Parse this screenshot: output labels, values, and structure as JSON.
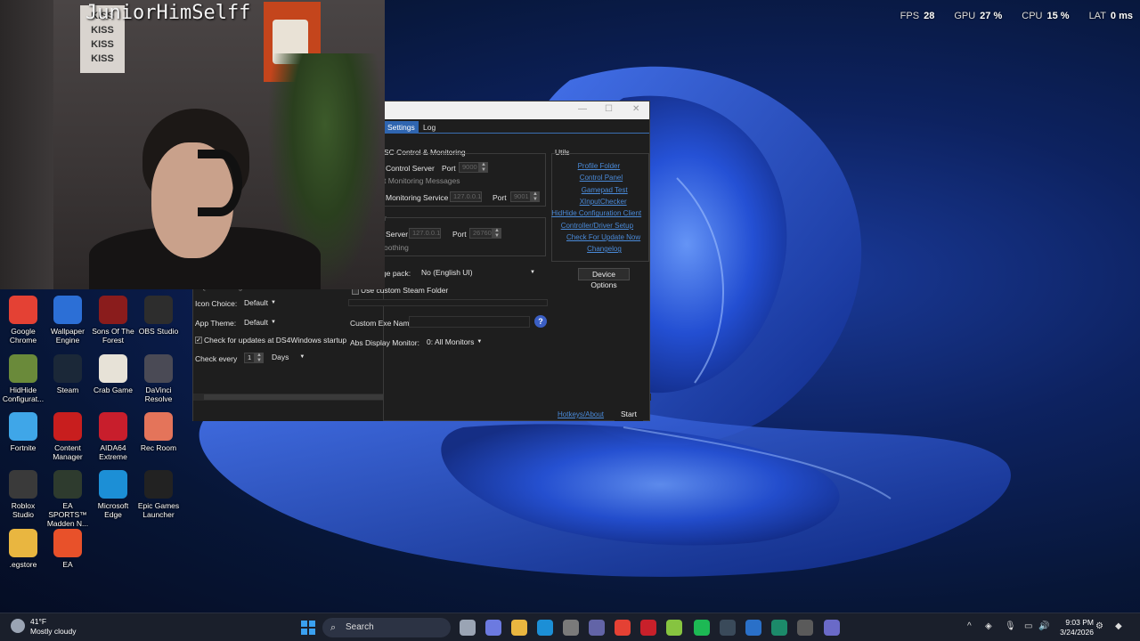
{
  "overlay": {
    "fps_label": "FPS",
    "fps": "28",
    "gpu_label": "GPU",
    "gpu": "27 %",
    "cpu_label": "CPU",
    "cpu": "15 %",
    "lat_label": "LAT",
    "lat": "0 ms"
  },
  "webcam": {
    "name": "JuniorHimSelff",
    "poster_text": [
      "KISS",
      "KISS",
      "KISS",
      "KISS"
    ]
  },
  "desktop_icons": [
    {
      "label": "Google Chrome",
      "icon": "chrome-icon",
      "color": "#e44134"
    },
    {
      "label": "Wallpaper Engine",
      "icon": "wallpaper-engine-icon",
      "color": "#2c6fd6"
    },
    {
      "label": "Sons Of The Forest",
      "icon": "sons-of-the-forest-icon",
      "color": "#8a1c1c"
    },
    {
      "label": "OBS Studio",
      "icon": "obs-icon",
      "color": "#2d2d2d"
    },
    {
      "label": "HidHide Configurat...",
      "icon": "hidhide-icon",
      "color": "#6a8a3a"
    },
    {
      "label": "Steam",
      "icon": "steam-icon",
      "color": "#1b2838"
    },
    {
      "label": "Crab Game",
      "icon": "crab-game-icon",
      "color": "#e7e2d7"
    },
    {
      "label": "DaVinci Resolve",
      "icon": "davinci-icon",
      "color": "#4a4a55"
    },
    {
      "label": "Fortnite",
      "icon": "fortnite-icon",
      "color": "#3fa6e8"
    },
    {
      "label": "Content Manager",
      "icon": "content-manager-icon",
      "color": "#c81e1e"
    },
    {
      "label": "AIDA64 Extreme",
      "icon": "aida64-icon",
      "color": "#c81e2c"
    },
    {
      "label": "Rec Room",
      "icon": "rec-room-icon",
      "color": "#e4745a"
    },
    {
      "label": "Roblox Studio",
      "icon": "roblox-icon",
      "color": "#3a3a3a"
    },
    {
      "label": "EA SPORTS™ Madden N...",
      "icon": "madden-icon",
      "color": "#2e3b2e"
    },
    {
      "label": "Microsoft Edge",
      "icon": "edge-icon",
      "color": "#1c8fd6"
    },
    {
      "label": "Epic Games Launcher",
      "icon": "epic-games-icon",
      "color": "#222222"
    },
    {
      "label": ".egstore",
      "icon": "folder-icon",
      "color": "#e9b640"
    },
    {
      "label": "EA",
      "icon": "ea-icon",
      "color": "#e8512a"
    }
  ],
  "window": {
    "tabs": [
      "Settings",
      "Log"
    ],
    "osc_group": "SC Control & Monitoring",
    "control_server": "Control Server",
    "port_label": "Port",
    "port_1": "9000",
    "monitoring_messages": "t Monitoring Messages",
    "monitoring_service": "Monitoring Service",
    "ip_1": "127.0.0.1",
    "port_2": "9001",
    "group2_title": "r",
    "server_label": "Server",
    "ip_2": "127.0.0.1",
    "port_3": "26760",
    "smoothing": "oothing",
    "utils_title": "Utils",
    "utils_links": [
      "Profile Folder",
      "Control Panel",
      "Gamepad Test",
      "XInputChecker",
      "HidHide Configuration Client",
      "Controller/Driver Setup",
      "Check For Update Now",
      "Changelog"
    ],
    "language_label": "ge pack:",
    "language_value": "No (English UI)",
    "device_options": "Device Options",
    "quick_charge": "Quick Charge",
    "use_custom_steam": "Use custom Steam Folder",
    "icon_choice_label": "Icon Choice:",
    "icon_choice_value": "Default",
    "app_theme_label": "App Theme:",
    "app_theme_value": "Default",
    "check_updates": "Check for updates at DS4Windows startup",
    "check_every_label": "Check every",
    "check_every_value": "1",
    "check_every_unit": "Days",
    "custom_exe_label": "Custom Exe Name",
    "abs_display_label": "Abs Display Monitor:",
    "abs_display_value": "0: All Monitors",
    "hotkeys_about": "Hotkeys/About",
    "start_button": "Start"
  },
  "taskbar": {
    "weather_temp": "41°F",
    "weather_desc": "Mostly cloudy",
    "search": "Search",
    "time": "9:03 PM",
    "date": "3/24/2026",
    "apps": [
      {
        "name": "task-view-icon",
        "color": "#9aa4b4"
      },
      {
        "name": "copilot-icon",
        "color": "#6c7ae0"
      },
      {
        "name": "file-explorer-icon",
        "color": "#e9b640"
      },
      {
        "name": "edge-icon",
        "color": "#1c8fd6"
      },
      {
        "name": "store-icon",
        "color": "#7a7a7a"
      },
      {
        "name": "teams-icon",
        "color": "#6264a7"
      },
      {
        "name": "chrome-icon",
        "color": "#e44134"
      },
      {
        "name": "acrobat-icon",
        "color": "#c8202a"
      },
      {
        "name": "vegas-icon",
        "color": "#86c440"
      },
      {
        "name": "spotify-icon",
        "color": "#1db954"
      },
      {
        "name": "app-icon-1",
        "color": "#3a4a5a"
      },
      {
        "name": "app-icon-2",
        "color": "#2a70c8"
      },
      {
        "name": "app-icon-3",
        "color": "#1c8a6a"
      },
      {
        "name": "app-icon-4",
        "color": "#5a5a5a"
      },
      {
        "name": "ds4windows-icon",
        "color": "#6a6ac8"
      }
    ]
  }
}
